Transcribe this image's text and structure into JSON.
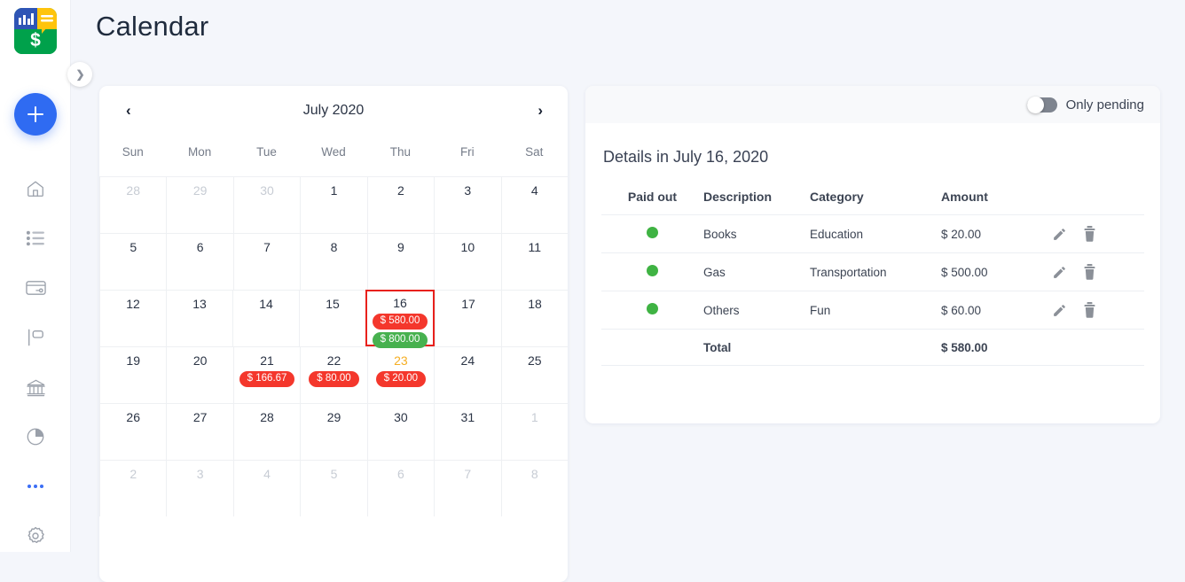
{
  "app": {
    "logo": {
      "name": "finance-logo",
      "dollar": "$"
    },
    "collapse_icon": "chevron-right-icon",
    "add_button_icon": "plus-icon",
    "nav_items": [
      {
        "icon": "home-icon",
        "name": "home"
      },
      {
        "icon": "list-icon",
        "name": "transactions"
      },
      {
        "icon": "credit-card-icon",
        "name": "cards"
      },
      {
        "icon": "flag-icon",
        "name": "goals"
      },
      {
        "icon": "bank-icon",
        "name": "accounts"
      },
      {
        "icon": "pie-chart-icon",
        "name": "reports"
      },
      {
        "icon": "more-dots-icon",
        "name": "more"
      },
      {
        "icon": "gear-icon",
        "name": "settings"
      }
    ]
  },
  "header": {
    "title": "Calendar"
  },
  "calendar": {
    "month_label": "July 2020",
    "prev_icon": "‹",
    "next_icon": "›",
    "weekdays": [
      "Sun",
      "Mon",
      "Tue",
      "Wed",
      "Thu",
      "Fri",
      "Sat"
    ],
    "weeks": [
      [
        {
          "day": "28",
          "muted": true
        },
        {
          "day": "29",
          "muted": true
        },
        {
          "day": "30",
          "muted": true
        },
        {
          "day": "1"
        },
        {
          "day": "2"
        },
        {
          "day": "3"
        },
        {
          "day": "4"
        }
      ],
      [
        {
          "day": "5"
        },
        {
          "day": "6"
        },
        {
          "day": "7"
        },
        {
          "day": "8"
        },
        {
          "day": "9"
        },
        {
          "day": "10"
        },
        {
          "day": "11"
        }
      ],
      [
        {
          "day": "12"
        },
        {
          "day": "13"
        },
        {
          "day": "14"
        },
        {
          "day": "15"
        },
        {
          "day": "16",
          "selected": true,
          "badges": [
            {
              "text": "$ 580.00",
              "kind": "expense"
            },
            {
              "text": "$ 800.00",
              "kind": "income"
            }
          ]
        },
        {
          "day": "17"
        },
        {
          "day": "18"
        }
      ],
      [
        {
          "day": "19"
        },
        {
          "day": "20"
        },
        {
          "day": "21",
          "badges": [
            {
              "text": "$ 166.67",
              "kind": "expense"
            }
          ]
        },
        {
          "day": "22",
          "badges": [
            {
              "text": "$ 80.00",
              "kind": "expense"
            }
          ]
        },
        {
          "day": "23",
          "today": true,
          "badges": [
            {
              "text": "$ 20.00",
              "kind": "expense"
            }
          ]
        },
        {
          "day": "24"
        },
        {
          "day": "25"
        }
      ],
      [
        {
          "day": "26"
        },
        {
          "day": "27"
        },
        {
          "day": "28"
        },
        {
          "day": "29"
        },
        {
          "day": "30"
        },
        {
          "day": "31"
        },
        {
          "day": "1",
          "muted": true
        }
      ],
      [
        {
          "day": "2",
          "muted": true
        },
        {
          "day": "3",
          "muted": true
        },
        {
          "day": "4",
          "muted": true
        },
        {
          "day": "5",
          "muted": true
        },
        {
          "day": "6",
          "muted": true
        },
        {
          "day": "7",
          "muted": true
        },
        {
          "day": "8",
          "muted": true
        }
      ]
    ]
  },
  "details": {
    "toggle_label": "Only pending",
    "toggle_on": false,
    "title": "Details in July 16, 2020",
    "columns": [
      "Paid out",
      "Description",
      "Category",
      "Amount",
      ""
    ],
    "rows": [
      {
        "paid": true,
        "description": "Books",
        "category": "Education",
        "amount": "$ 20.00",
        "edit_icon": "pencil-icon",
        "delete_icon": "trash-icon"
      },
      {
        "paid": true,
        "description": "Gas",
        "category": "Transportation",
        "amount": "$ 500.00",
        "edit_icon": "pencil-icon",
        "delete_icon": "trash-icon"
      },
      {
        "paid": true,
        "description": "Others",
        "category": "Fun",
        "amount": "$ 60.00",
        "edit_icon": "pencil-icon",
        "delete_icon": "trash-icon"
      }
    ],
    "total_label": "Total",
    "total_amount": "$ 580.00"
  },
  "colors": {
    "accent": "#2f6bf2",
    "expense": "#f4372c",
    "income": "#47b14f",
    "today": "#f5ae23",
    "selected_border": "#e8211c",
    "amount_negative": "#d6342c",
    "page_bg": "#f4f6fb"
  }
}
